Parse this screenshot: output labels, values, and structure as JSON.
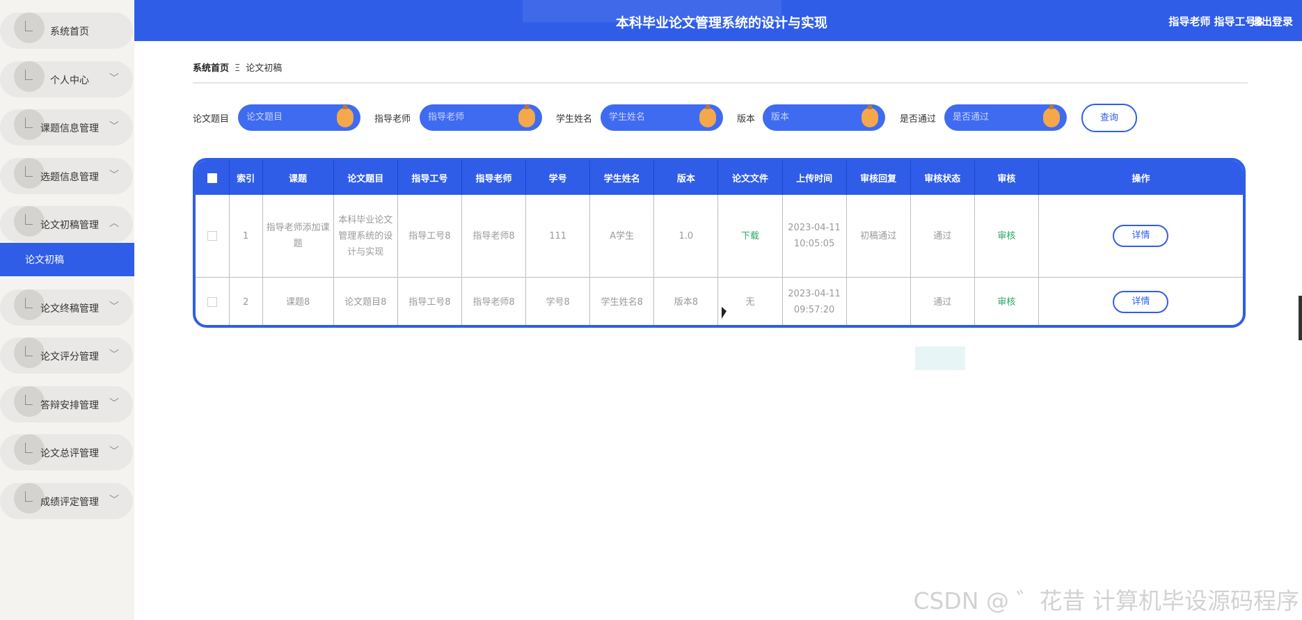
{
  "sidebar": {
    "items": [
      {
        "label": "系统首页",
        "chevron": false
      },
      {
        "label": "个人中心",
        "chevron": true
      },
      {
        "label": "课题信息管理",
        "chevron": true
      },
      {
        "label": "选题信息管理",
        "chevron": true
      },
      {
        "label": "论文初稿管理",
        "chevron": true,
        "expanded": true
      },
      {
        "label": "论文终稿管理",
        "chevron": true
      },
      {
        "label": "论文评分管理",
        "chevron": true
      },
      {
        "label": "答辩安排管理",
        "chevron": true
      },
      {
        "label": "论文总评管理",
        "chevron": true
      },
      {
        "label": "成绩评定管理",
        "chevron": true
      }
    ],
    "active_sub": "论文初稿"
  },
  "header": {
    "title": "本科毕业论文管理系统的设计与实现",
    "user": "指导老师 指导工号8",
    "logout": "退出登录"
  },
  "breadcrumb": {
    "home": "系统首页",
    "separator": "Ξ",
    "current": "论文初稿"
  },
  "filters": [
    {
      "label": "论文题目",
      "placeholder": "论文题目"
    },
    {
      "label": "指导老师",
      "placeholder": "指导老师"
    },
    {
      "label": "学生姓名",
      "placeholder": "学生姓名"
    },
    {
      "label": "版本",
      "placeholder": "版本"
    },
    {
      "label": "是否通过",
      "placeholder": "是否通过"
    }
  ],
  "query_button": "查询",
  "table": {
    "headers": [
      "索引",
      "课题",
      "论文题目",
      "指导工号",
      "指导老师",
      "学号",
      "学生姓名",
      "版本",
      "论文文件",
      "上传时间",
      "审核回复",
      "审核状态",
      "审核",
      "操作"
    ],
    "rows": [
      {
        "index": "1",
        "topic": "指导老师添加课题",
        "title": "本科毕业论文管理系统的设计与实现",
        "teacher_id": "指导工号8",
        "teacher": "指导老师8",
        "student_no": "111",
        "student_name": "A学生",
        "version": "1.0",
        "file": "下载",
        "upload_time": "2023-04-11 10:05:05",
        "reply": "初稿通过",
        "status": "通过",
        "review": "审核",
        "action": "详情"
      },
      {
        "index": "2",
        "topic": "课题8",
        "title": "论文题目8",
        "teacher_id": "指导工号8",
        "teacher": "指导老师8",
        "student_no": "学号8",
        "student_name": "学生姓名8",
        "version": "版本8",
        "file": "无",
        "upload_time": "2023-04-11 09:57:20",
        "reply": "",
        "status": "通过",
        "review": "审核",
        "action": "详情"
      }
    ]
  },
  "watermark": "CSDN @ ゛花昔  计算机毕设源码程序",
  "colors": {
    "primary": "#2f5de8",
    "accent_knob": "#f4a84b",
    "green_link": "#2aa56b",
    "sidebar_bg": "#f5f3ef"
  }
}
